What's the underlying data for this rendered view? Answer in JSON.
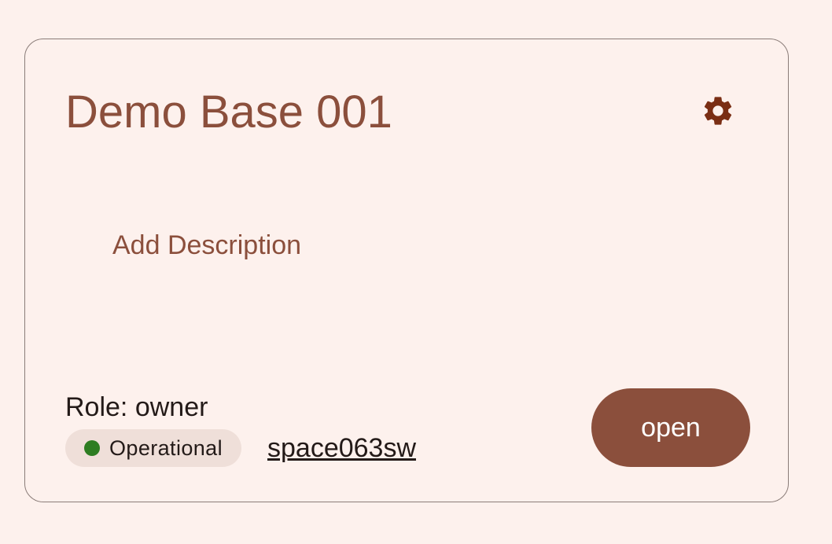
{
  "card": {
    "title": "Demo Base 001",
    "settings_icon": "gear-icon",
    "add_description_label": "Add Description",
    "role_text": "Role: owner",
    "status": {
      "label": "Operational",
      "color": "#2e7d22"
    },
    "space_link": "space063sw",
    "open_button_label": "open"
  },
  "colors": {
    "accent": "#8b4f3c",
    "background": "#fdf1ed",
    "badge_background": "#efdfd9"
  }
}
